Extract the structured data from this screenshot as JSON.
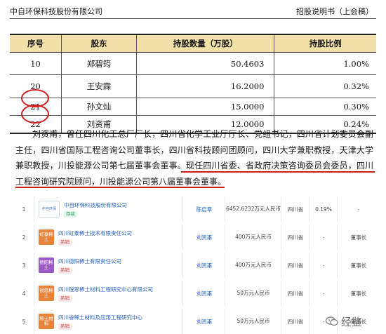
{
  "header": {
    "company": "中自环保科技股份有限公司",
    "doc_title": "招股说明书（上会稿）"
  },
  "shareholders": {
    "columns": [
      "序号",
      "股东",
      "持股数量（万股）",
      "持股比例"
    ],
    "rows": [
      {
        "no": "10",
        "name": "郑碧筠",
        "shares": "50.4603",
        "ratio": "1.00%"
      },
      {
        "no": "20",
        "name": "王安霖",
        "shares": "16.2000",
        "ratio": "0.32%"
      },
      {
        "no": "21",
        "name": "孙文灿",
        "shares": "15.0000",
        "ratio": "0.30%"
      },
      {
        "no": "22",
        "name": "刘资甫",
        "shares": "12.0000",
        "ratio": "0.24%"
      }
    ]
  },
  "bio": {
    "part1": "刘资甫，曾任四川化工总厂厂长，四川省化学工业厅厅长、党组书记，四川省计划委员会副主任，四川省国际工程咨询公司董事长，四川省科技顾问团顾问，四川大学兼职教授，天津大学兼职教授，川投能源公司第七届董事会董事。",
    "part2": "现任四川省委、省政府决策咨询委员会委员，四川工程咨询研究院顾问，川投能源公司第八届董事会董事",
    "part3": "。"
  },
  "companies": [
    {
      "index": "1",
      "logo_text": "中自环保",
      "name": "中自环保科技股份有限公司",
      "status": "存续",
      "person": "陈启章",
      "capital": "6452.6232万元人民币",
      "province": "四川省",
      "ratio": "0.19%",
      "role": "-"
    },
    {
      "index": "2",
      "logo_text": "虹泰稀土",
      "name": "四川虹泰稀土技术有限责任公司",
      "status": "吊销",
      "person": "刘资甫",
      "capital": "400万元人民币",
      "province": "四川省",
      "ratio": "-",
      "role": "董事长"
    },
    {
      "index": "3",
      "logo_text": "德阳稀土",
      "name": "四川德阳稀土有限责任公司",
      "status": "吊销",
      "person": "刘资甫",
      "capital": "400万元人民币",
      "province": "四川省",
      "ratio": "-",
      "role": "董事长"
    },
    {
      "index": "4",
      "logo_text": "锐思稀土",
      "name": "四川锐思稀土材料工程研究中心有限公司",
      "status": "吊销",
      "person": "刘资甫",
      "capital": "50万元人民币",
      "province": "四川省",
      "ratio": "-",
      "role": "董事长"
    },
    {
      "index": "5",
      "logo_text": "稀土材料",
      "name": "四川省稀土材料及应用工程研究中心",
      "status": "吊销",
      "person": "刘资甫",
      "capital": "50万元人民币",
      "province": "四川省",
      "ratio": "-",
      "role": "董事长"
    }
  ],
  "colors": {
    "highlight_red": "#d41e1e",
    "table_header_bg": "#f1e0a8",
    "link_blue": "#2563c8",
    "logo_colors": [
      "#ffffff",
      "#e8833a",
      "#9b59c6",
      "#e8833a",
      "#e8833a"
    ]
  },
  "watermark": {
    "text": "经鉴",
    "icon": "wechat-bubble-icon"
  }
}
